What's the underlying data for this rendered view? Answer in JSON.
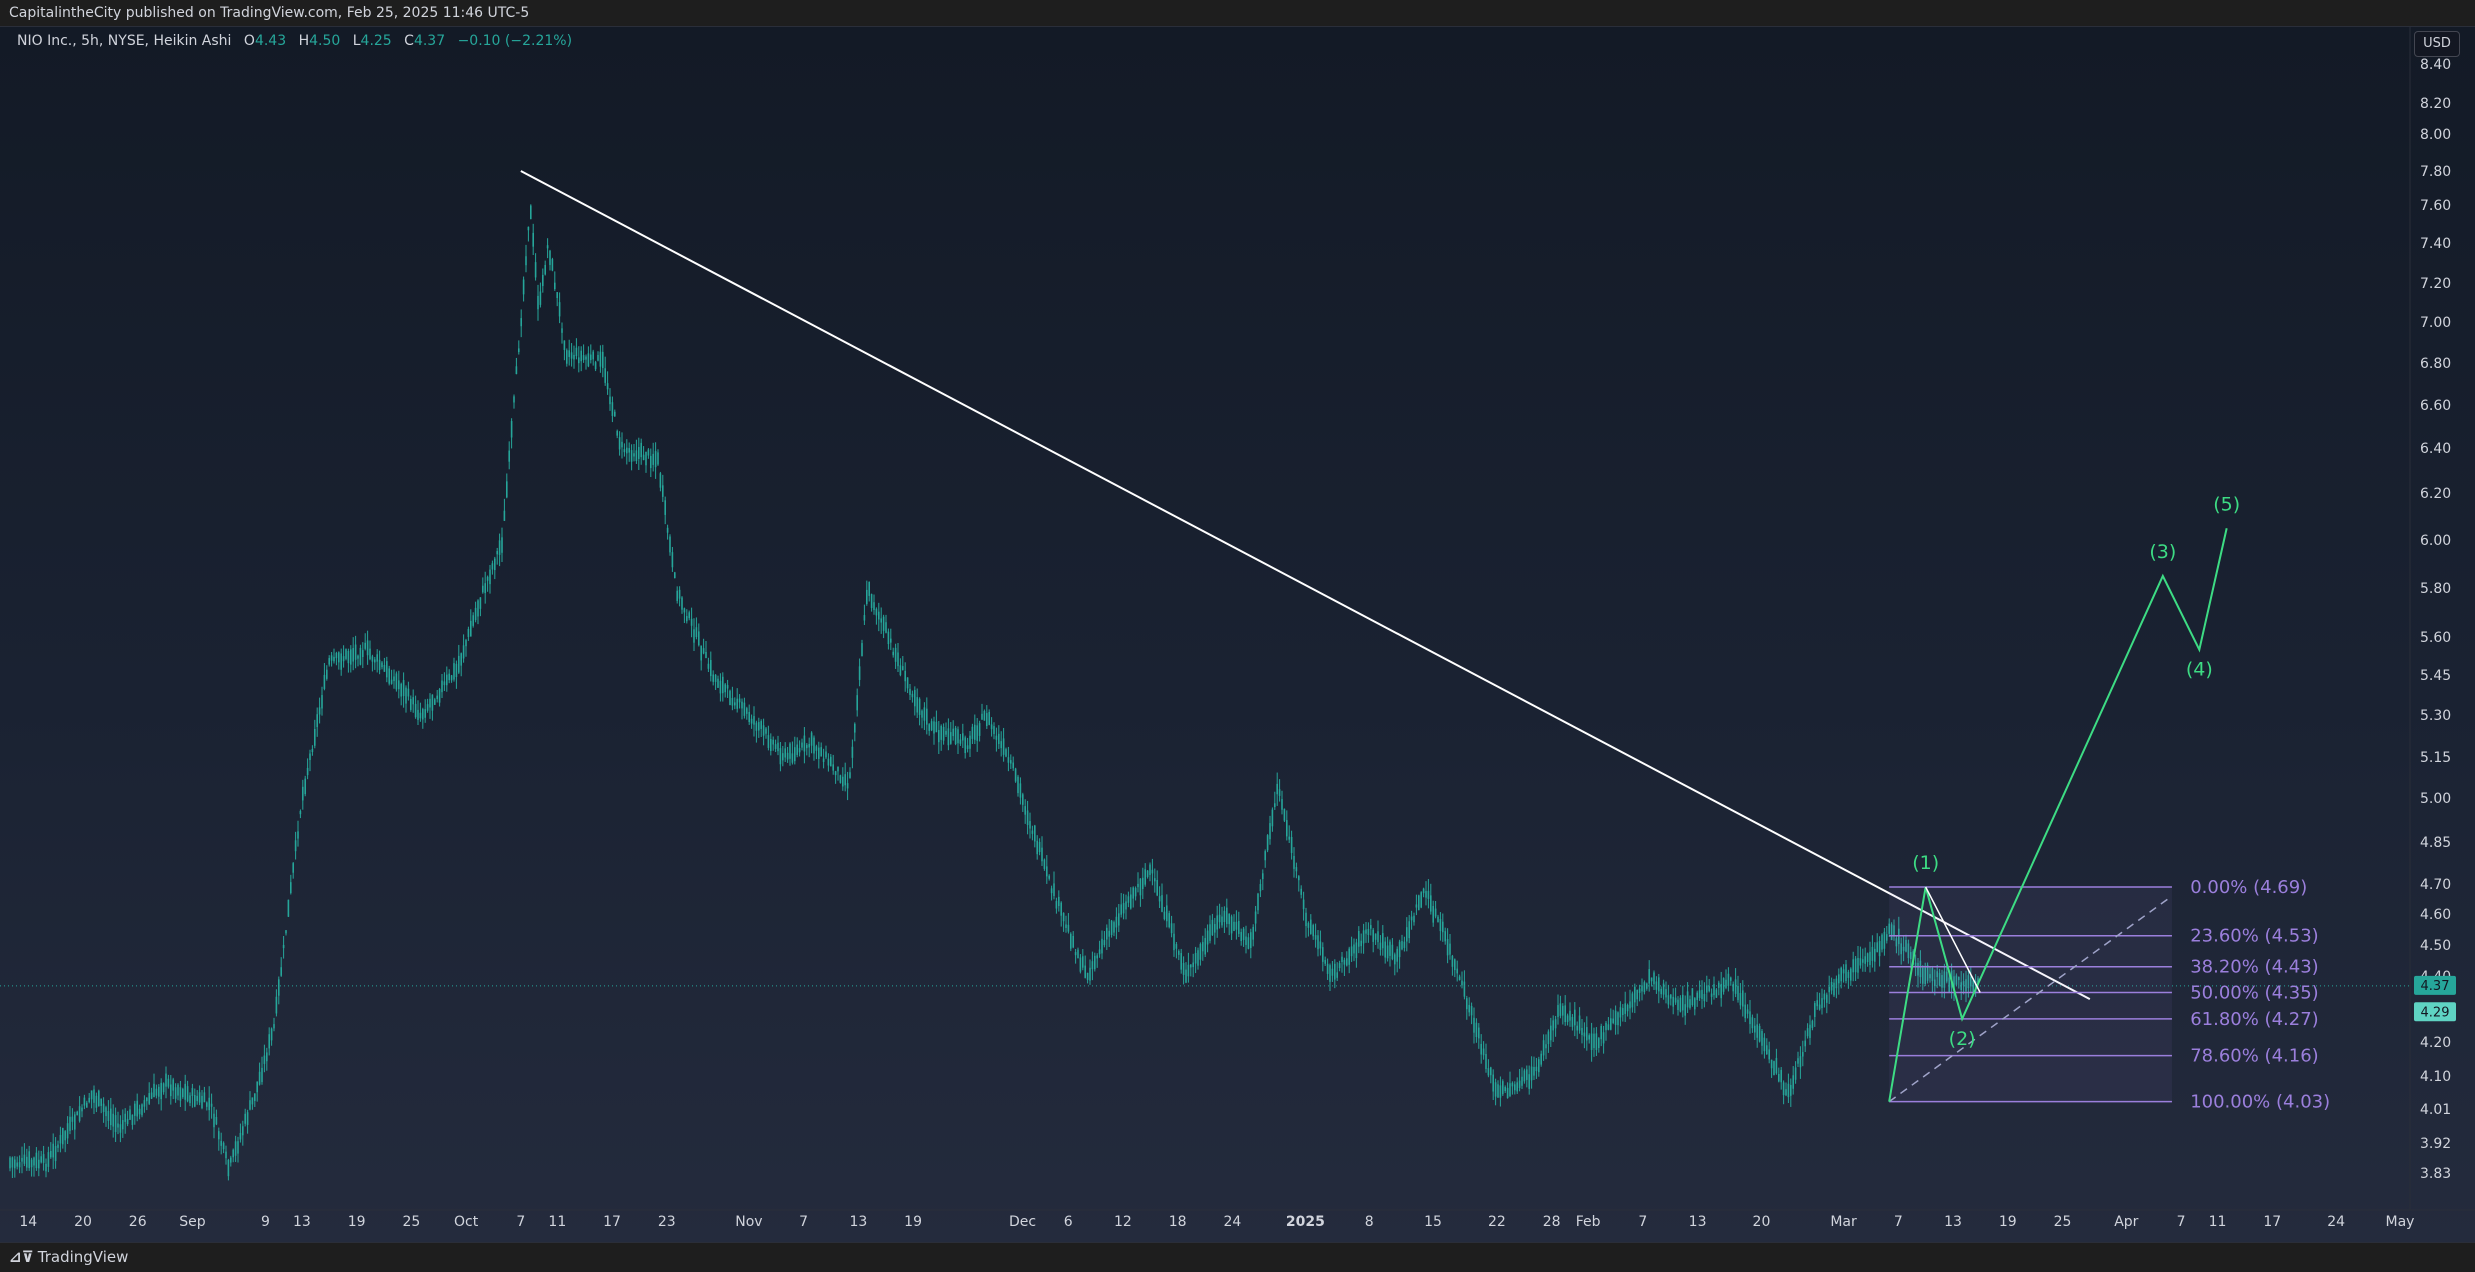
{
  "header": {
    "publisher": "CapitalintheCity published on TradingView.com, Feb 25, 2025 11:46 UTC-5"
  },
  "legend": {
    "symbol": "NIO Inc., 5h, NYSE, Heikin Ashi",
    "open_label": "O",
    "open": "4.43",
    "high_label": "H",
    "high": "4.50",
    "low_label": "L",
    "low": "4.25",
    "close_label": "C",
    "close": "4.37",
    "change": "−0.10 (−2.21%)"
  },
  "currency_button": "USD",
  "footer": {
    "logo": "⊿⊽",
    "brand": "TradingView"
  },
  "price_tags": [
    {
      "value": "4.37",
      "price": 4.37,
      "color": "#26a69a"
    },
    {
      "value": "4.29",
      "price": 4.29,
      "color": "#5fd3c3"
    }
  ],
  "chart_data": {
    "type": "candlestick",
    "style": "Heikin Ashi",
    "colors": {
      "up": "#26a69a",
      "down": "#26a69a",
      "trendline": "#ffffff",
      "wave": "#3ddc84",
      "fib": "#9b7fdc"
    },
    "y_axis": {
      "ticks": [
        {
          "label": "8.40",
          "value": 8.4
        },
        {
          "label": "8.20",
          "value": 8.2
        },
        {
          "label": "8.00",
          "value": 8.0
        },
        {
          "label": "7.80",
          "value": 7.8
        },
        {
          "label": "7.60",
          "value": 7.6
        },
        {
          "label": "7.40",
          "value": 7.4
        },
        {
          "label": "7.20",
          "value": 7.2
        },
        {
          "label": "7.00",
          "value": 7.0
        },
        {
          "label": "6.80",
          "value": 6.8
        },
        {
          "label": "6.60",
          "value": 6.6
        },
        {
          "label": "6.40",
          "value": 6.4
        },
        {
          "label": "6.20",
          "value": 6.2
        },
        {
          "label": "6.00",
          "value": 6.0
        },
        {
          "label": "5.80",
          "value": 5.8
        },
        {
          "label": "5.60",
          "value": 5.6
        },
        {
          "label": "5.45",
          "value": 5.45
        },
        {
          "label": "5.30",
          "value": 5.3
        },
        {
          "label": "5.15",
          "value": 5.15
        },
        {
          "label": "5.00",
          "value": 5.0
        },
        {
          "label": "4.85",
          "value": 4.85
        },
        {
          "label": "4.70",
          "value": 4.7
        },
        {
          "label": "4.60",
          "value": 4.6
        },
        {
          "label": "4.50",
          "value": 4.5
        },
        {
          "label": "4.40",
          "value": 4.4
        },
        {
          "label": "4.20",
          "value": 4.2
        },
        {
          "label": "4.10",
          "value": 4.1
        },
        {
          "label": "4.01",
          "value": 4.01
        },
        {
          "label": "3.92",
          "value": 3.92
        },
        {
          "label": "3.83",
          "value": 3.83
        }
      ]
    },
    "x_axis": {
      "start": "2024-08-12",
      "end": "2025-05-01",
      "ticks": [
        {
          "label": "14",
          "date": "2024-08-14"
        },
        {
          "label": "20",
          "date": "2024-08-20"
        },
        {
          "label": "26",
          "date": "2024-08-26"
        },
        {
          "label": "Sep",
          "date": "2024-09-01"
        },
        {
          "label": "9",
          "date": "2024-09-09"
        },
        {
          "label": "13",
          "date": "2024-09-13"
        },
        {
          "label": "19",
          "date": "2024-09-19"
        },
        {
          "label": "25",
          "date": "2024-09-25"
        },
        {
          "label": "Oct",
          "date": "2024-10-01"
        },
        {
          "label": "7",
          "date": "2024-10-07"
        },
        {
          "label": "11",
          "date": "2024-10-11"
        },
        {
          "label": "17",
          "date": "2024-10-17"
        },
        {
          "label": "23",
          "date": "2024-10-23"
        },
        {
          "label": "Nov",
          "date": "2024-11-01"
        },
        {
          "label": "7",
          "date": "2024-11-07"
        },
        {
          "label": "13",
          "date": "2024-11-13"
        },
        {
          "label": "19",
          "date": "2024-11-19"
        },
        {
          "label": "Dec",
          "date": "2024-12-01"
        },
        {
          "label": "6",
          "date": "2024-12-06"
        },
        {
          "label": "12",
          "date": "2024-12-12"
        },
        {
          "label": "18",
          "date": "2024-12-18"
        },
        {
          "label": "24",
          "date": "2024-12-24"
        },
        {
          "label": "2025",
          "date": "2025-01-01",
          "bold": true
        },
        {
          "label": "8",
          "date": "2025-01-08"
        },
        {
          "label": "15",
          "date": "2025-01-15"
        },
        {
          "label": "22",
          "date": "2025-01-22"
        },
        {
          "label": "28",
          "date": "2025-01-28"
        },
        {
          "label": "Feb",
          "date": "2025-02-01"
        },
        {
          "label": "7",
          "date": "2025-02-07"
        },
        {
          "label": "13",
          "date": "2025-02-13"
        },
        {
          "label": "20",
          "date": "2025-02-20"
        },
        {
          "label": "Mar",
          "date": "2025-03-01"
        },
        {
          "label": "7",
          "date": "2025-03-07"
        },
        {
          "label": "13",
          "date": "2025-03-13"
        },
        {
          "label": "19",
          "date": "2025-03-19"
        },
        {
          "label": "25",
          "date": "2025-03-25"
        },
        {
          "label": "Apr",
          "date": "2025-04-01"
        },
        {
          "label": "7",
          "date": "2025-04-07"
        },
        {
          "label": "11",
          "date": "2025-04-11"
        },
        {
          "label": "17",
          "date": "2025-04-17"
        },
        {
          "label": "24",
          "date": "2025-04-24"
        },
        {
          "label": "May",
          "date": "2025-05-01"
        }
      ]
    },
    "price_path": [
      {
        "date": "2024-08-12",
        "price": 3.86
      },
      {
        "date": "2024-08-16",
        "price": 3.86
      },
      {
        "date": "2024-08-21",
        "price": 4.05
      },
      {
        "date": "2024-08-24",
        "price": 3.96
      },
      {
        "date": "2024-08-29",
        "price": 4.08
      },
      {
        "date": "2024-09-03",
        "price": 4.02
      },
      {
        "date": "2024-09-05",
        "price": 3.84
      },
      {
        "date": "2024-09-08",
        "price": 4.06
      },
      {
        "date": "2024-09-10",
        "price": 4.25
      },
      {
        "date": "2024-09-13",
        "price": 5.0
      },
      {
        "date": "2024-09-16",
        "price": 5.5
      },
      {
        "date": "2024-09-20",
        "price": 5.55
      },
      {
        "date": "2024-09-24",
        "price": 5.4
      },
      {
        "date": "2024-09-26",
        "price": 5.3
      },
      {
        "date": "2024-09-30",
        "price": 5.47
      },
      {
        "date": "2024-10-03",
        "price": 5.8
      },
      {
        "date": "2024-10-05",
        "price": 6.0
      },
      {
        "date": "2024-10-07",
        "price": 7.0
      },
      {
        "date": "2024-10-08",
        "price": 7.6
      },
      {
        "date": "2024-10-09",
        "price": 7.05
      },
      {
        "date": "2024-10-10",
        "price": 7.4
      },
      {
        "date": "2024-10-12",
        "price": 6.85
      },
      {
        "date": "2024-10-16",
        "price": 6.8
      },
      {
        "date": "2024-10-18",
        "price": 6.4
      },
      {
        "date": "2024-10-22",
        "price": 6.35
      },
      {
        "date": "2024-10-24",
        "price": 5.8
      },
      {
        "date": "2024-10-28",
        "price": 5.45
      },
      {
        "date": "2024-11-01",
        "price": 5.3
      },
      {
        "date": "2024-11-05",
        "price": 5.15
      },
      {
        "date": "2024-11-08",
        "price": 5.2
      },
      {
        "date": "2024-11-12",
        "price": 5.05
      },
      {
        "date": "2024-11-14",
        "price": 5.8
      },
      {
        "date": "2024-11-18",
        "price": 5.45
      },
      {
        "date": "2024-11-21",
        "price": 5.25
      },
      {
        "date": "2024-11-25",
        "price": 5.2
      },
      {
        "date": "2024-11-27",
        "price": 5.3
      },
      {
        "date": "2024-11-30",
        "price": 5.1
      },
      {
        "date": "2024-12-04",
        "price": 4.7
      },
      {
        "date": "2024-12-08",
        "price": 4.4
      },
      {
        "date": "2024-12-12",
        "price": 4.62
      },
      {
        "date": "2024-12-15",
        "price": 4.75
      },
      {
        "date": "2024-12-19",
        "price": 4.4
      },
      {
        "date": "2024-12-23",
        "price": 4.6
      },
      {
        "date": "2024-12-26",
        "price": 4.5
      },
      {
        "date": "2024-12-29",
        "price": 5.05
      },
      {
        "date": "2025-01-01",
        "price": 4.6
      },
      {
        "date": "2025-01-04",
        "price": 4.4
      },
      {
        "date": "2025-01-08",
        "price": 4.55
      },
      {
        "date": "2025-01-11",
        "price": 4.45
      },
      {
        "date": "2025-01-14",
        "price": 4.68
      },
      {
        "date": "2025-01-16",
        "price": 4.55
      },
      {
        "date": "2025-01-19",
        "price": 4.3
      },
      {
        "date": "2025-01-22",
        "price": 4.05
      },
      {
        "date": "2025-01-26",
        "price": 4.1
      },
      {
        "date": "2025-01-29",
        "price": 4.3
      },
      {
        "date": "2025-02-02",
        "price": 4.2
      },
      {
        "date": "2025-02-05",
        "price": 4.3
      },
      {
        "date": "2025-02-08",
        "price": 4.4
      },
      {
        "date": "2025-02-11",
        "price": 4.3
      },
      {
        "date": "2025-02-14",
        "price": 4.35
      },
      {
        "date": "2025-02-17",
        "price": 4.38
      },
      {
        "date": "2025-02-20",
        "price": 4.2
      },
      {
        "date": "2025-02-23",
        "price": 4.05
      },
      {
        "date": "2025-02-26",
        "price": 4.3
      },
      {
        "date": "2025-03-01",
        "price": 4.4
      },
      {
        "date": "2025-03-04",
        "price": 4.45
      },
      {
        "date": "2025-03-06",
        "price": 4.55
      },
      {
        "date": "2025-03-08",
        "price": 4.48
      },
      {
        "date": "2025-03-10",
        "price": 4.4
      },
      {
        "date": "2025-03-13",
        "price": 4.38
      },
      {
        "date": "2025-03-16",
        "price": 4.37
      }
    ],
    "trendline": {
      "from": {
        "date": "2024-10-07",
        "price": 7.8
      },
      "to": {
        "date": "2025-03-28",
        "price": 4.33
      }
    },
    "fib_retracement": {
      "from_date": "2025-03-06",
      "to_date": "2025-04-06",
      "label_date": "2025-04-08",
      "levels": [
        {
          "label": "0.00% (4.69)",
          "price": 4.69
        },
        {
          "label": "23.60% (4.53)",
          "price": 4.53
        },
        {
          "label": "38.20% (4.43)",
          "price": 4.43
        },
        {
          "label": "50.00% (4.35)",
          "price": 4.35
        },
        {
          "label": "61.80% (4.27)",
          "price": 4.27
        },
        {
          "label": "78.60% (4.16)",
          "price": 4.16
        },
        {
          "label": "100.00% (4.03)",
          "price": 4.03
        }
      ]
    },
    "elliott_wave": {
      "points": [
        {
          "label": "",
          "date": "2025-03-06",
          "price": 4.03
        },
        {
          "label": "(1)",
          "date": "2025-03-10",
          "price": 4.69
        },
        {
          "label": "(2)",
          "date": "2025-03-14",
          "price": 4.27
        },
        {
          "label": "(3)",
          "date": "2025-04-05",
          "price": 5.85
        },
        {
          "label": "(4)",
          "date": "2025-04-09",
          "price": 5.55
        },
        {
          "label": "(5)",
          "date": "2025-04-12",
          "price": 6.05
        }
      ]
    },
    "dashed_channel": {
      "from": {
        "date": "2025-03-06",
        "price": 4.03
      },
      "to": {
        "date": "2025-04-06",
        "price": 4.66
      }
    }
  }
}
